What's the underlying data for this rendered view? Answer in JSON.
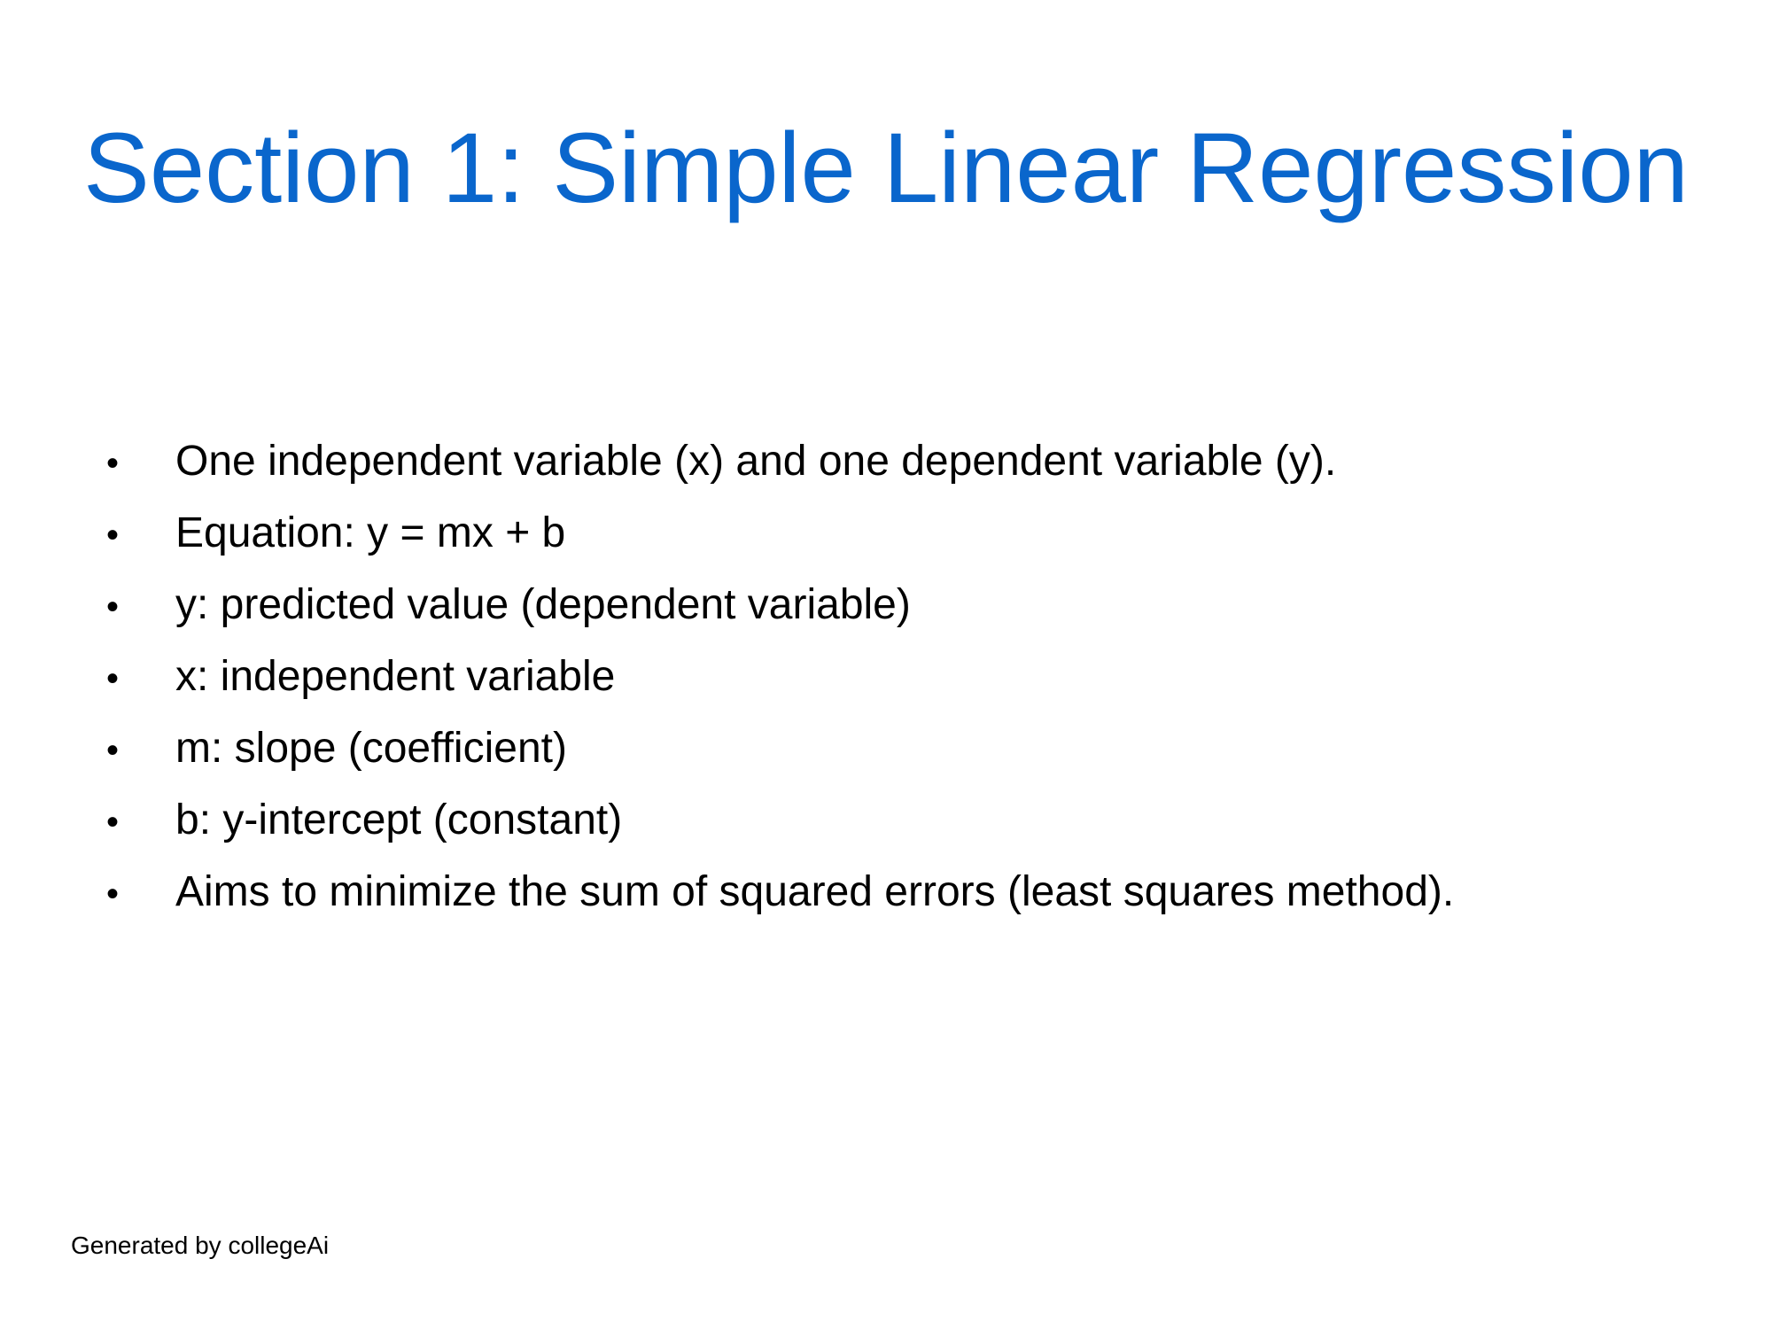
{
  "slide": {
    "title": "Section 1: Simple Linear Regression",
    "title_color": "#0A66CC",
    "bullet_glyph": "•",
    "bullets": [
      "One independent variable (x) and one dependent variable (y).",
      "Equation: y = mx + b",
      "y: predicted value (dependent variable)",
      "x: independent variable",
      "m: slope (coefficient)",
      "b: y-intercept (constant)",
      "Aims to minimize the sum of squared errors (least squares method)."
    ],
    "footer": "Generated by collegeAi"
  }
}
